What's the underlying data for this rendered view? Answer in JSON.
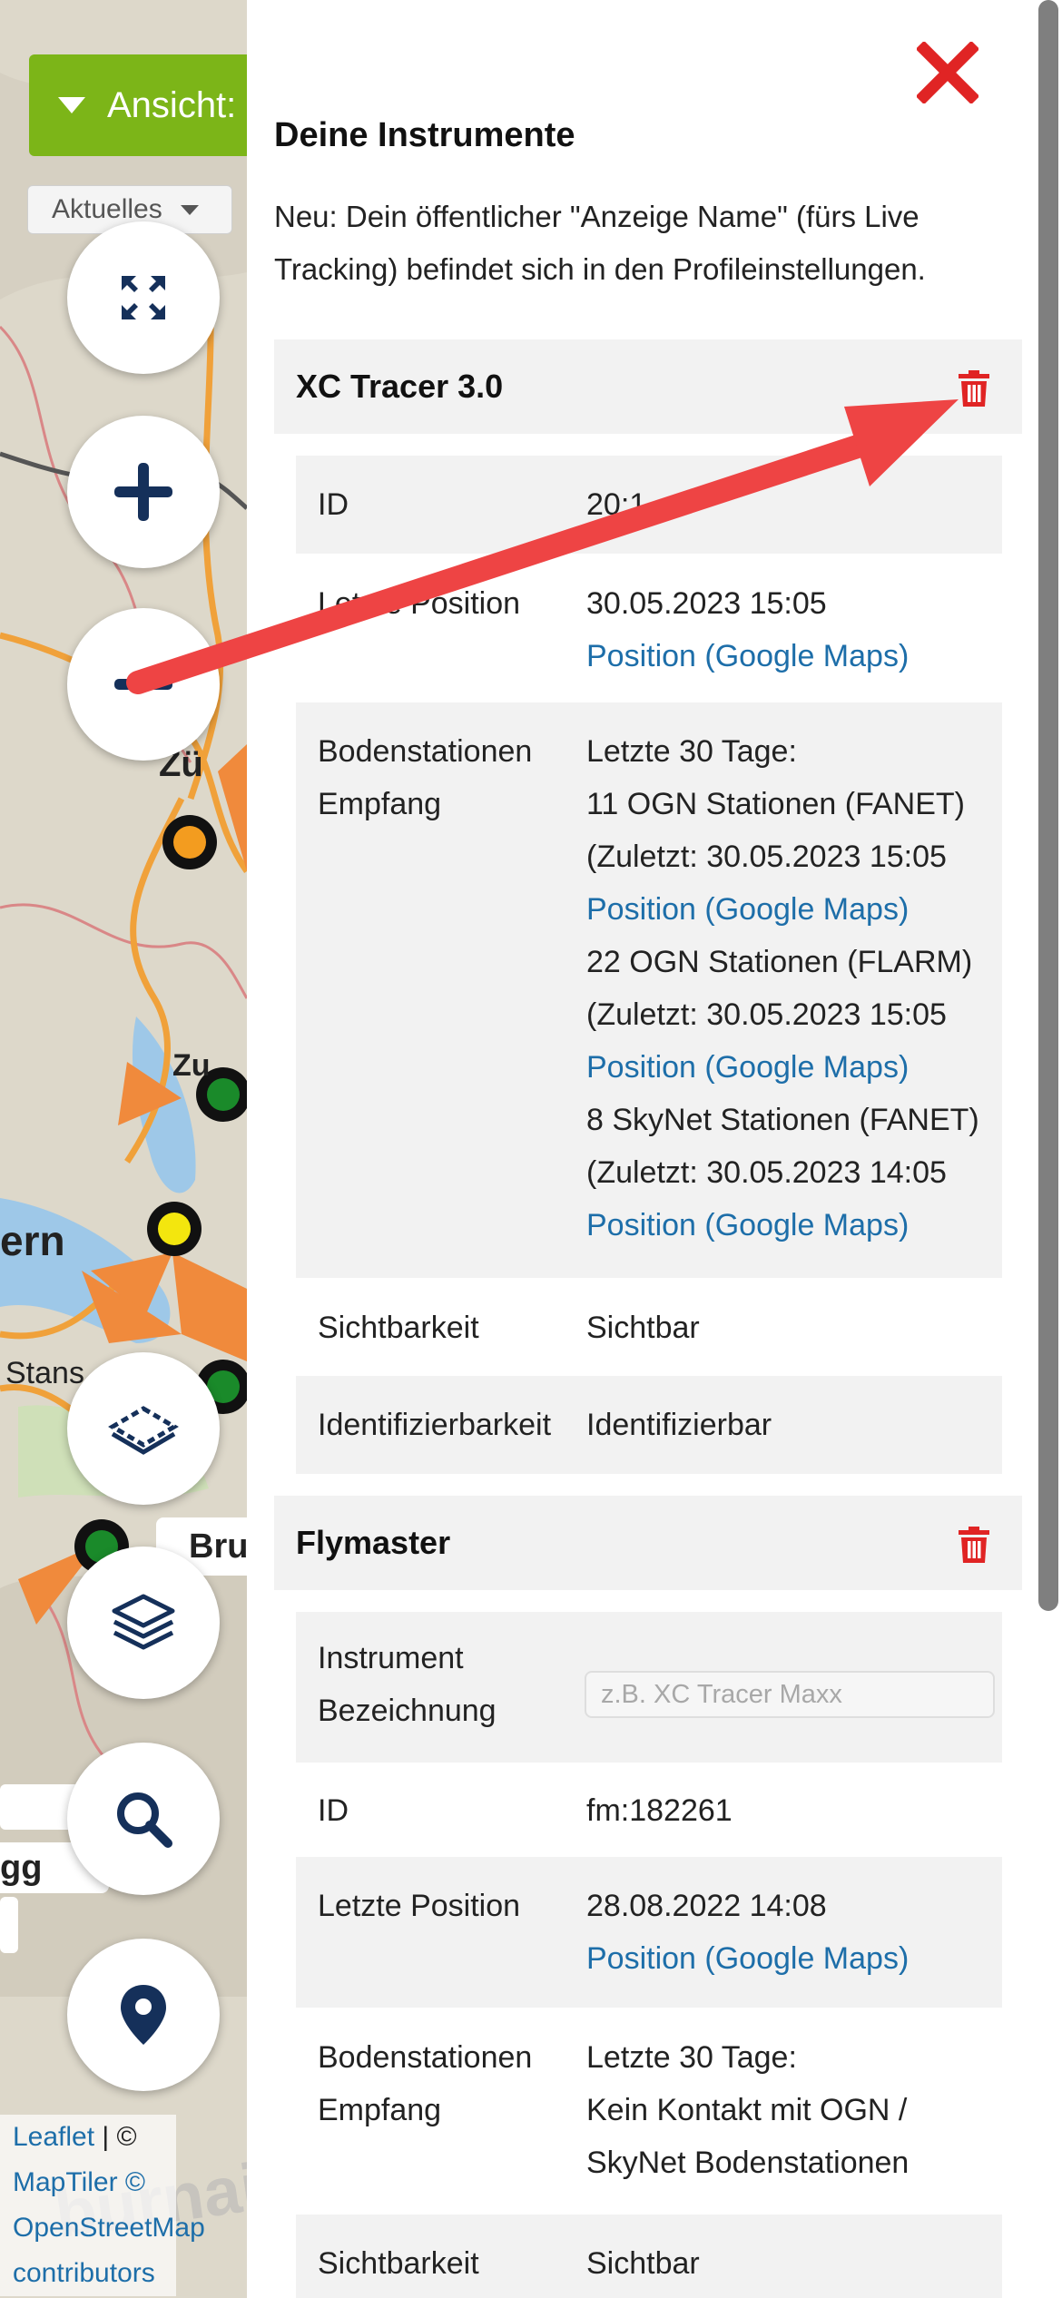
{
  "map": {
    "view_label": "Ansicht:",
    "filter_label": "Aktuelles",
    "labels": {
      "zuerich": "Zü",
      "zug": "Zu",
      "luzern": "ern",
      "stans": "Stans",
      "brunnen": "Bru",
      "lake": "gg"
    },
    "attribution": {
      "leaflet": "Leaflet",
      "sep": " | ©",
      "maptiler": "MapTiler ©",
      "osm": "OpenStreetMap",
      "contributors": "contributors"
    },
    "watermark": "burnair",
    "buttons": [
      "fullscreen-icon",
      "zoom-in-icon",
      "zoom-out-icon",
      "layers-outline-icon",
      "layers-stack-icon",
      "search-icon",
      "location-pin-icon"
    ]
  },
  "panel": {
    "heading": "Deine Instrumente",
    "intro": "Neu: Dein öffentlicher \"Anzeige Name\" (fürs Live Tracking) befindet sich in den Profileinstellungen.",
    "instruments": [
      {
        "name": "XC Tracer 3.0",
        "id_label": "ID",
        "id_value": "20:1",
        "last_position_label": "Letzte Position",
        "last_position_date": "30.05.2023 15:05",
        "position_link": "Position (Google Maps)",
        "ground_label_1": "Bodenstationen",
        "ground_label_2": "Empfang",
        "ground_lines": [
          "Letzte 30 Tage:",
          "11 OGN Stationen (FANET)",
          "(Zuletzt: 30.05.2023 15:05",
          "Position (Google Maps)",
          "22 OGN Stationen (FLARM)",
          "(Zuletzt: 30.05.2023 15:05",
          "Position (Google Maps)",
          "8 SkyNet Stationen (FANET)",
          "(Zuletzt: 30.05.2023 14:05",
          "Position (Google Maps)"
        ],
        "visibility_label": "Sichtbarkeit",
        "visibility_value": "Sichtbar",
        "identifiability_label": "Identifizierbarkeit",
        "identifiability_value": "Identifizierbar"
      },
      {
        "name": "Flymaster",
        "name_label_1": "Instrument",
        "name_label_2": "Bezeichnung",
        "name_placeholder": "z.B. XC Tracer Maxx",
        "id_label": "ID",
        "id_value": "fm:182261",
        "last_position_label": "Letzte Position",
        "last_position_date": "28.08.2022 14:08",
        "position_link": "Position (Google Maps)",
        "ground_label_1": "Bodenstationen",
        "ground_label_2": "Empfang",
        "ground_lines": [
          "Letzte 30 Tage:",
          "Kein Kontakt mit OGN /",
          "SkyNet Bodenstationen"
        ],
        "visibility_label": "Sichtbarkeit",
        "visibility_value": "Sichtbar"
      }
    ]
  },
  "colors": {
    "accent_green": "#7cb518",
    "danger_red": "#e02424",
    "link_blue": "#1d6ea9",
    "arrow_red": "#ee4444",
    "icon_navy": "#15305a"
  }
}
